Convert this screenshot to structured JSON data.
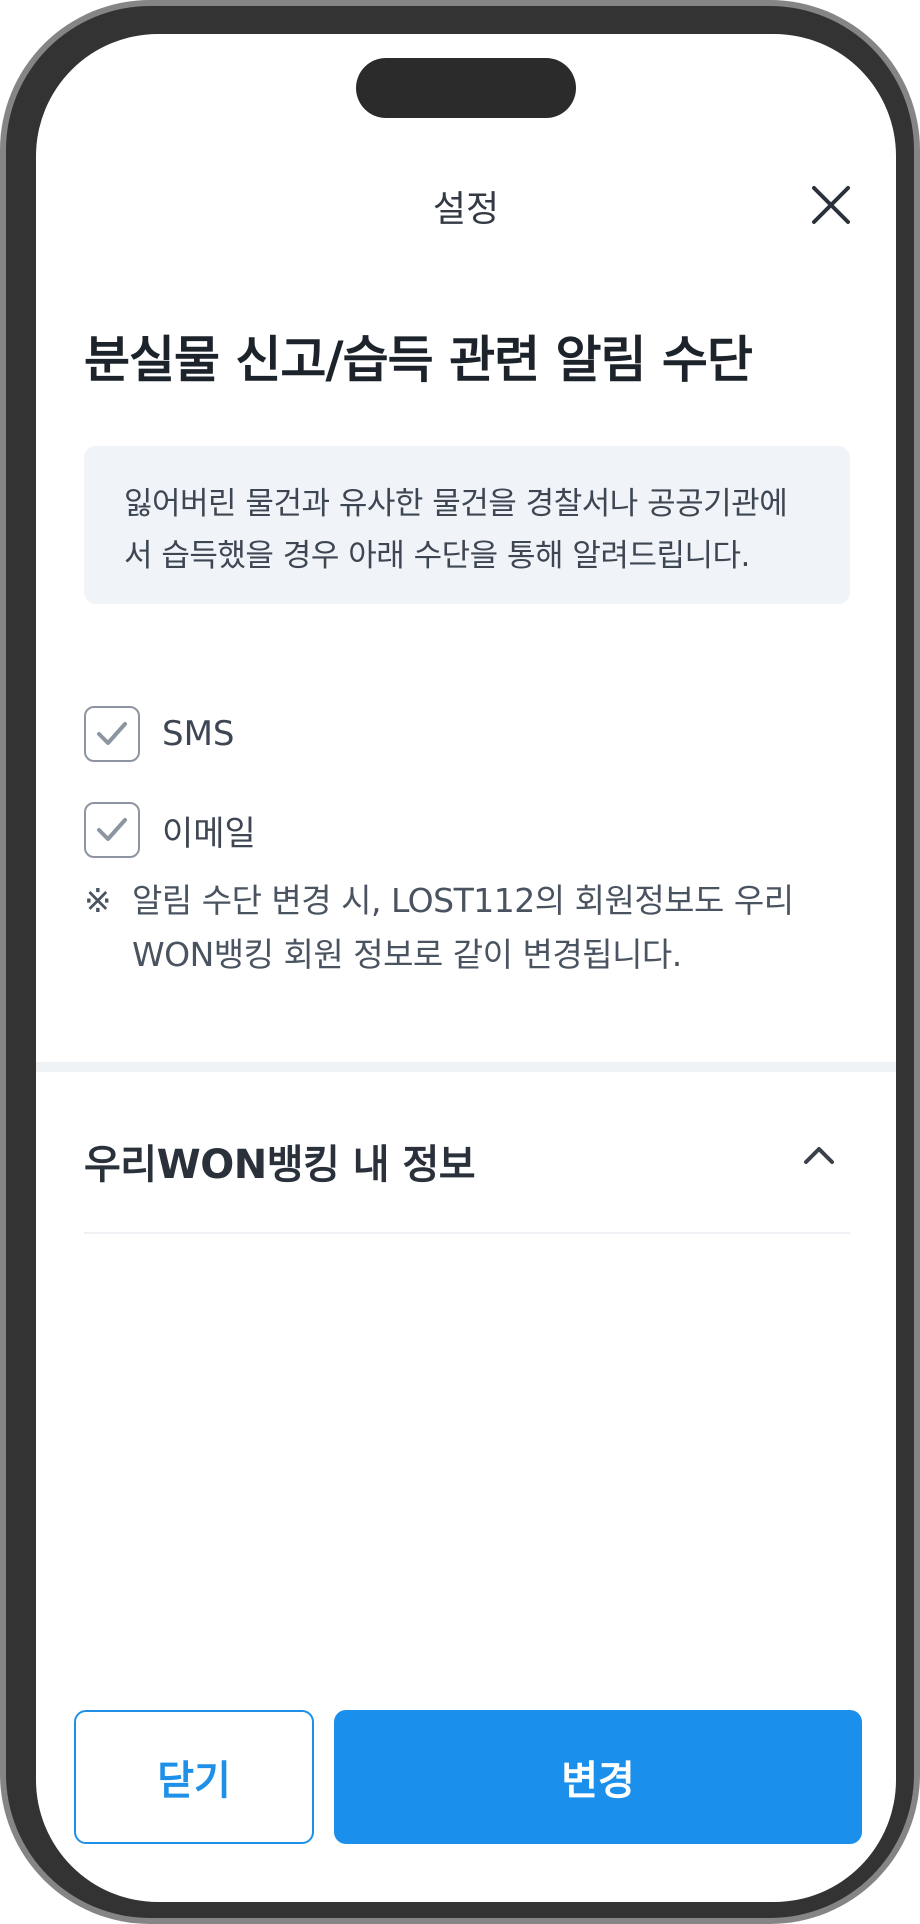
{
  "header": {
    "title": "설정",
    "close_icon": "close-icon"
  },
  "main": {
    "heading": "분실물 신고/습득 관련 알림 수단",
    "info_text": "잃어버린 물건과 유사한 물건을 경찰서나 공공기관에서 습득했을 경우 아래 수단을 통해 알려드립니다.",
    "options": [
      {
        "label": "SMS",
        "checked": true
      },
      {
        "label": "이메일",
        "checked": true
      }
    ],
    "notice_mark": "※",
    "notice_text": "알림 수단 변경 시, LOST112의 회원정보도 우리WON뱅킹 회원 정보로 같이 변경됩니다."
  },
  "section": {
    "title": "우리WON뱅킹 내 정보",
    "toggle_icon": "chevron-up-icon",
    "expanded": true
  },
  "footer": {
    "close_label": "닫기",
    "change_label": "변경"
  },
  "colors": {
    "accent": "#1a90ec",
    "info_bg": "#f0f4f8",
    "checkbox_border": "#8c95a0"
  }
}
